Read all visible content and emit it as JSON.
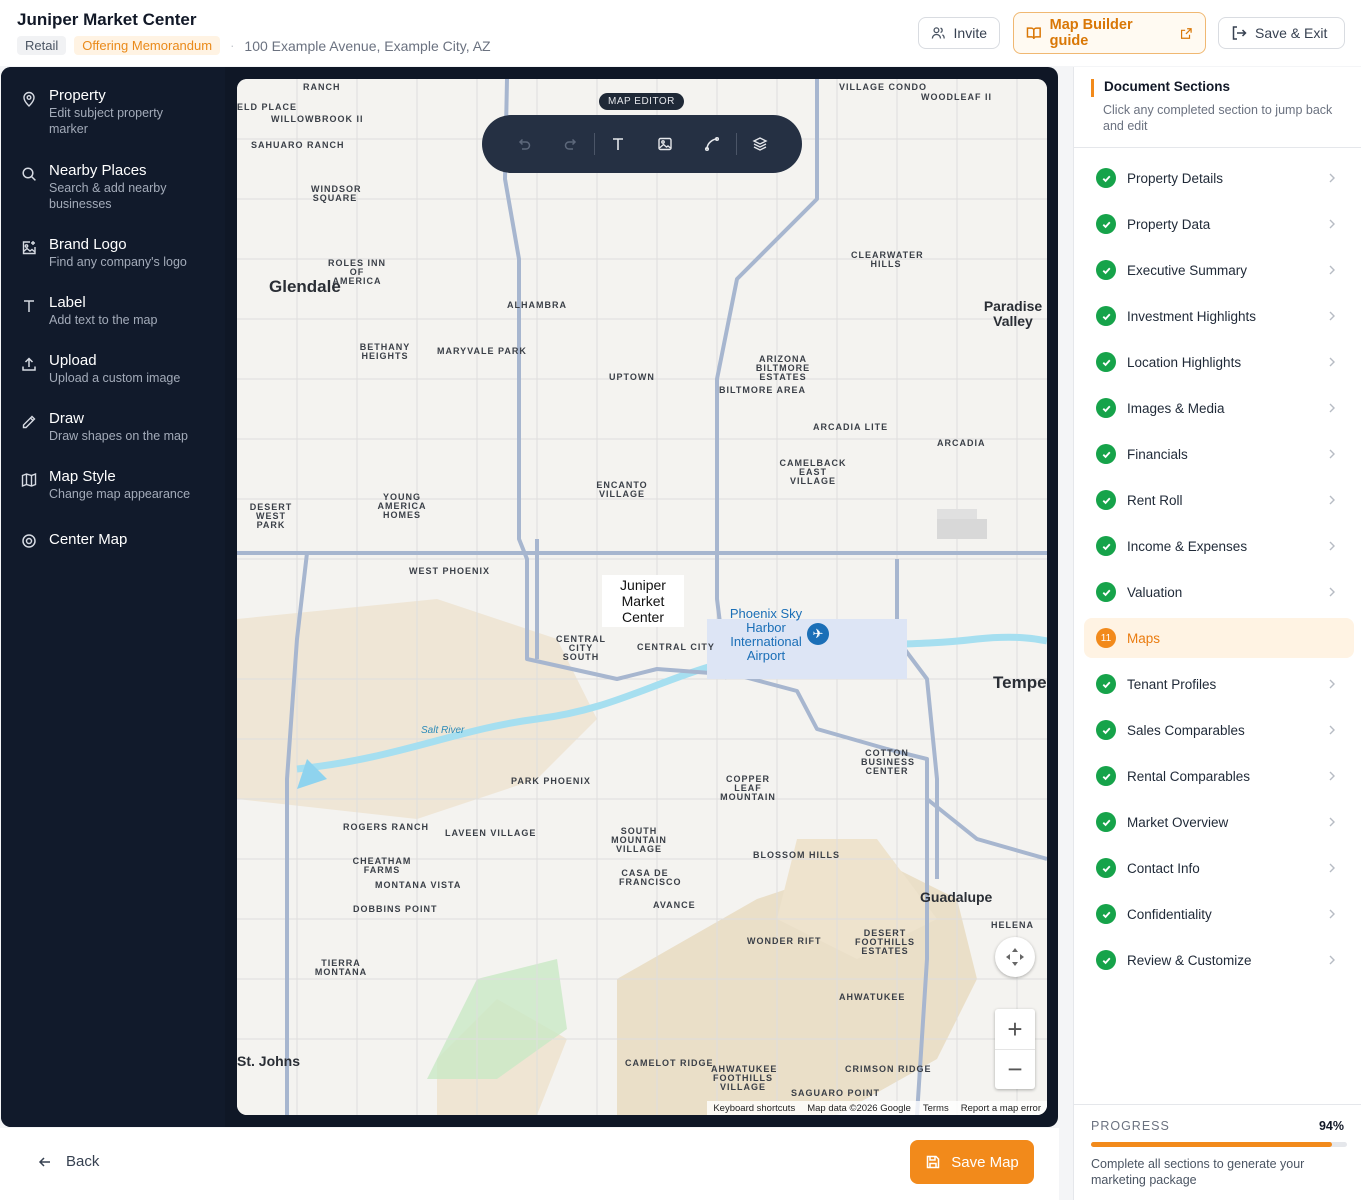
{
  "header": {
    "title": "Juniper Market Center",
    "tag_type": "Retail",
    "tag_doc": "Offering Memorandum",
    "separator": "·",
    "address": "100 Example Avenue, Example City, AZ",
    "invite_label": "Invite",
    "guide_label": "Map Builder guide",
    "save_exit_label": "Save & Exit"
  },
  "tools": [
    {
      "title": "Property",
      "sub": "Edit subject property marker",
      "icon": "location-pin-icon"
    },
    {
      "title": "Nearby Places",
      "sub": "Search & add nearby businesses",
      "icon": "search-icon"
    },
    {
      "title": "Brand Logo",
      "sub": "Find any company's logo",
      "icon": "image-add-icon"
    },
    {
      "title": "Label",
      "sub": "Add text to the map",
      "icon": "text-icon"
    },
    {
      "title": "Upload",
      "sub": "Upload a custom image",
      "icon": "upload-icon"
    },
    {
      "title": "Draw",
      "sub": "Draw shapes on the map",
      "icon": "pencil-icon"
    },
    {
      "title": "Map Style",
      "sub": "Change map appearance",
      "icon": "map-icon"
    },
    {
      "title": "Center Map",
      "sub": "",
      "icon": "target-icon"
    }
  ],
  "map": {
    "editor_badge": "MAP EDITOR",
    "marker_text": "Juniper Market Center",
    "attribution": [
      "Keyboard shortcuts",
      "Map data ©2026 Google",
      "Terms",
      "Report a map error"
    ],
    "places": [
      "RANCH",
      "VILLAGE CONDO",
      "WOODLEAF II",
      "ELD PLACE",
      "WILLOWBROOK II",
      "SAHUARO RANCH",
      "WINDSOR SQUARE",
      "ROLES INN OF AMERICA",
      "CLEARWATER HILLS",
      "ALHAMBRA",
      "BETHANY HEIGHTS",
      "MARYVALE PARK",
      "UPTOWN",
      "ARIZONA BILTMORE ESTATES",
      "BILTMORE AREA",
      "ARCADIA LITE",
      "ARCADIA",
      "CAMELBACK EAST VILLAGE",
      "ENCANTO VILLAGE",
      "YOUNG AMERICA HOMES",
      "DESERT WEST PARK",
      "WEST PHOENIX",
      "CENTRAL CITY SOUTH",
      "CENTRAL CITY",
      "PARK PHOENIX",
      "COPPER LEAF MOUNTAIN",
      "COTTON BUSINESS CENTER",
      "ROGERS RANCH",
      "LAVEEN VILLAGE",
      "SOUTH MOUNTAIN VILLAGE",
      "BLOSSOM HILLS",
      "CHEATHAM FARMS",
      "MONTANA VISTA",
      "CASA DE FRANCISCO",
      "DOBBINS POINT",
      "AVANCE",
      "WONDER RIFT",
      "DESERT FOOTHILLS ESTATES",
      "TIERRA MONTANA",
      "AHWATUKEE",
      "CAMELOT RIDGE",
      "AHWATUKEE FOOTHILLS VILLAGE",
      "CRIMSON RIDGE",
      "SAGUARO POINT",
      "HELENA"
    ],
    "cities": [
      "Glendale",
      "Paradise Valley",
      "Tempe",
      "Guadalupe",
      "St. Johns"
    ],
    "airport": "Phoenix Sky Harbor International Airport",
    "river": "Salt River"
  },
  "footer": {
    "back_label": "Back",
    "save_map_label": "Save Map"
  },
  "sections": {
    "title": "Document Sections",
    "subtitle": "Click any completed section to jump back and edit",
    "items": [
      {
        "label": "Property Details",
        "status": "done"
      },
      {
        "label": "Property Data",
        "status": "done"
      },
      {
        "label": "Executive Summary",
        "status": "done"
      },
      {
        "label": "Investment Highlights",
        "status": "done"
      },
      {
        "label": "Location Highlights",
        "status": "done"
      },
      {
        "label": "Images & Media",
        "status": "done"
      },
      {
        "label": "Financials",
        "status": "done"
      },
      {
        "label": "Rent Roll",
        "status": "done"
      },
      {
        "label": "Income & Expenses",
        "status": "done"
      },
      {
        "label": "Valuation",
        "status": "done"
      },
      {
        "label": "Maps",
        "status": "active",
        "number": "11"
      },
      {
        "label": "Tenant Profiles",
        "status": "done"
      },
      {
        "label": "Sales Comparables",
        "status": "done"
      },
      {
        "label": "Rental Comparables",
        "status": "done"
      },
      {
        "label": "Market Overview",
        "status": "done"
      },
      {
        "label": "Contact Info",
        "status": "done"
      },
      {
        "label": "Confidentiality",
        "status": "done"
      },
      {
        "label": "Review & Customize",
        "status": "done"
      }
    ]
  },
  "progress": {
    "label": "PROGRESS",
    "value_text": "94%",
    "value": 0.94,
    "note": "Complete all sections to generate your marketing package"
  },
  "colors": {
    "accent": "#f28a1b",
    "done": "#16a34a",
    "editor_bg": "#0f1726"
  }
}
